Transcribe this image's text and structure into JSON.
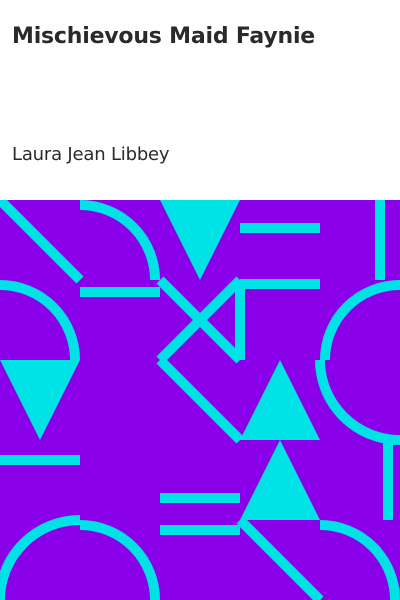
{
  "book": {
    "title": "Mischievous Maid Faynie",
    "author": "Laura Jean Libbey"
  },
  "colors": {
    "background": "#ffffff",
    "text": "#2a2a2a",
    "art_background": "#8a00e8",
    "art_pattern": "#00e3e6"
  },
  "art": {
    "pattern": "geometric-tile-pattern"
  }
}
